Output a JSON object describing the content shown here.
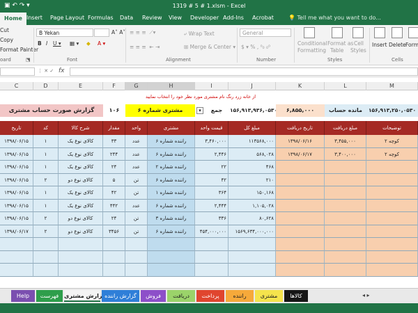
{
  "window": {
    "title": "1319 # 5 # 1.xlsm - Excel"
  },
  "tabs": [
    "Home",
    "Insert",
    "Page Layout",
    "Formulas",
    "Data",
    "Review",
    "View",
    "Developer",
    "Add-Ins",
    "Acrobat"
  ],
  "tell_me": "Tell me what you want to do...",
  "ribbon": {
    "clipboard": {
      "cut": "Cut",
      "copy": "Copy",
      "format_painter": "Format Painter",
      "group": "oard"
    },
    "font": {
      "name": "B Yekan",
      "group": "Font"
    },
    "alignment": {
      "wrap": "Wrap Text",
      "merge": "Merge & Center",
      "group": "Alignment"
    },
    "number": {
      "format": "General",
      "group": "Number"
    },
    "styles": {
      "conditional": [
        "Conditional",
        "Formatting"
      ],
      "format_as": [
        "Format as",
        "Table"
      ],
      "cell_styles": [
        "Cell",
        "Styles"
      ],
      "group": "Styles"
    },
    "cells": {
      "insert": "Insert",
      "delete": "Delete",
      "format": "Format",
      "group": "Cells"
    }
  },
  "columns": [
    "C",
    "D",
    "E",
    "F",
    "G",
    "H",
    "I",
    "J",
    "K",
    "L",
    "M"
  ],
  "selected_columns": [
    "G",
    "H"
  ],
  "report": {
    "instruction": "از خانه زرد رنگ نام مشتری مورد نظر خود را انتخاب نمایید",
    "title": "گزارش صورت حساب مشتری",
    "customer_code": "۱۰۶",
    "customer_name": "مشتری شماره ۶",
    "sum_label": "جمع",
    "sum_total": "۱۵۶,۹۱۳,۹۳۶,۰۵۳۰",
    "sum_received": "۶,۸۵۵,۰۰۰",
    "balance_label": "مانده حساب",
    "balance_value": "۱۵۶,۹۱۳,۲۵۰,۰۵۳۰"
  },
  "table": {
    "headers": {
      "date": "تاریخ",
      "code": "کد",
      "desc": "شرح کالا",
      "qty": "مقدار",
      "unit": "واحد",
      "driver": "مشتری",
      "price": "قیمت واحد",
      "total": "مبلغ کل",
      "recv_date": "تاریخ دریافت",
      "recv_amount": "مبلغ دریافت",
      "notes": "توضیحات"
    },
    "rows": [
      {
        "date": "۱۳۹۸/۰۶/۱۵",
        "code": "۱",
        "desc": "کالای نوع یک",
        "qty": "۳۳",
        "unit": "عدد",
        "driver": "راننده شماره ۶",
        "price": "۳,۴۶۰,۰۰۰",
        "total": "۱۱۳۵۶۸,۰۰۰",
        "recv_date": "۱۳۹۸/۰۶/۱۶",
        "recv_amount": "۳,۴۵۵,۰۰۰",
        "notes": "کوچه ۲"
      },
      {
        "date": "۱۳۹۸/۰۶/۱۵",
        "code": "۱",
        "desc": "کالای نوع یک",
        "qty": "۲۴۴",
        "unit": "عدد",
        "driver": "راننده شماره ۶",
        "price": "۲,۴۴۶",
        "total": "۵۶۸,۰۲۸",
        "recv_date": "۱۳۹۸/۰۶/۱۷",
        "recv_amount": "۳,۴۰۰,۰۰۰",
        "notes": "کوچه ۲"
      },
      {
        "date": "۱۳۹۸/۰۶/۱۵",
        "code": "۱",
        "desc": "کالای نوع یک",
        "qty": "۲۴",
        "unit": "عدد",
        "driver": "راننده شماره ۲",
        "price": "۲۲",
        "total": "۴۶۸",
        "recv_date": "",
        "recv_amount": "",
        "notes": ""
      },
      {
        "date": "۱۳۹۸/۰۶/۱۵",
        "code": "۲",
        "desc": "کالای نوع دو",
        "qty": "۵",
        "unit": "تن",
        "driver": "راننده شماره ۶",
        "price": "۴۲",
        "total": "۲۱۰",
        "recv_date": "",
        "recv_amount": "",
        "notes": ""
      },
      {
        "date": "۱۳۹۸/۰۶/۱۵",
        "code": "۱",
        "desc": "کالای نوع یک",
        "qty": "۴۲",
        "unit": "تن",
        "driver": "راننده شماره ۱",
        "price": "۳۶۴",
        "total": "۱۵۰,۱۶۸",
        "recv_date": "",
        "recv_amount": "",
        "notes": ""
      },
      {
        "date": "۱۳۹۸/۰۶/۱۵",
        "code": "۱",
        "desc": "کالای نوع یک",
        "qty": "۴۴۲",
        "unit": "عدد",
        "driver": "راننده شماره ۶",
        "price": "۲,۴۴۴",
        "total": "۱,۱۰۵,۰۲۸",
        "recv_date": "",
        "recv_amount": "",
        "notes": ""
      },
      {
        "date": "۱۳۹۸/۰۶/۱۵",
        "code": "۲",
        "desc": "کالای نوع دو",
        "qty": "۲۴",
        "unit": "تن",
        "driver": "راننده شماره ۳",
        "price": "۳۳۶",
        "total": "۸۰,۶۲۸",
        "recv_date": "",
        "recv_amount": "",
        "notes": ""
      },
      {
        "date": "۱۳۹۸/۰۶/۱۷",
        "code": "۲",
        "desc": "کالای نوع دو",
        "qty": "۳۴۵۶",
        "unit": "تن",
        "driver": "راننده شماره ۶",
        "price": "۴۵۴,۰۰۰,۰۰۰",
        "total": "۱۵۶۹,۶۳۴,۰۰۰,۰۰۰",
        "recv_date": "",
        "recv_amount": "",
        "notes": ""
      }
    ],
    "empty_rows": 3
  },
  "sheet_tabs": [
    {
      "label": "Help",
      "color": "#7b4fb0",
      "text": "#ffffff"
    },
    {
      "label": "فهرست",
      "color": "#2e9e4b",
      "text": "#ffffff"
    },
    {
      "label": "گزارش مشتری",
      "color": "#f4f4f4",
      "text": "#222222"
    },
    {
      "label": "گزارش راننده",
      "color": "#2f7fd8",
      "text": "#ffffff"
    },
    {
      "label": "فروش",
      "color": "#8d4fc9",
      "text": "#ffffff"
    },
    {
      "label": "دریافت",
      "color": "#9bd36a",
      "text": "#222222"
    },
    {
      "label": "پرداخت",
      "color": "#e0452e",
      "text": "#ffffff"
    },
    {
      "label": "راننده",
      "color": "#f6a93a",
      "text": "#222222"
    },
    {
      "label": "مشتری",
      "color": "#f5e34c",
      "text": "#222222"
    },
    {
      "label": "کالاها",
      "color": "#161616",
      "text": "#ffffff"
    }
  ],
  "colors": {
    "excel_green": "#217346",
    "header_red": "#a52a24",
    "light_blue": "#dcecf5",
    "mid_blue": "#bfdcee",
    "peach": "#f8cfae",
    "yellow": "#ffff00",
    "pink": "#f2c6c6"
  }
}
